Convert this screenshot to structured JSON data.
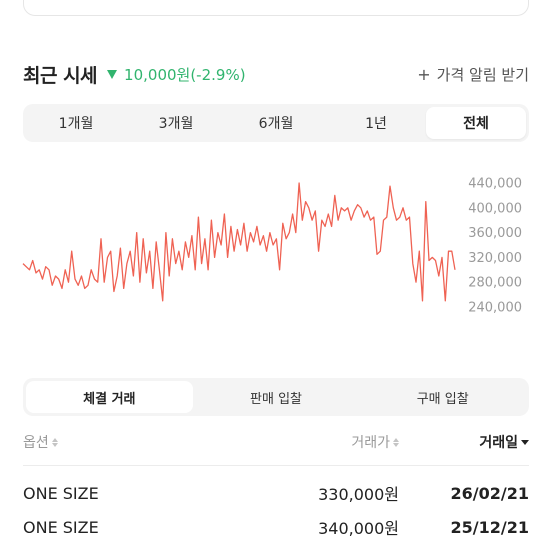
{
  "header": {
    "title": "최근 시세",
    "change_text": "10,000원(-2.9%)",
    "change_color": "#31b46e",
    "alert_label": "가격 알림 받기"
  },
  "period_tabs": [
    {
      "label": "1개월",
      "active": false
    },
    {
      "label": "3개월",
      "active": false
    },
    {
      "label": "6개월",
      "active": false
    },
    {
      "label": "1년",
      "active": false
    },
    {
      "label": "전체",
      "active": true
    }
  ],
  "chart_data": {
    "type": "line",
    "line_color": "#ef6253",
    "y_ticks": [
      "440,000",
      "400,000",
      "360,000",
      "320,000",
      "280,000",
      "240,000"
    ],
    "ylim": [
      240000,
      440000
    ],
    "values": [
      310000,
      305000,
      300000,
      315000,
      295000,
      300000,
      285000,
      305000,
      300000,
      275000,
      290000,
      285000,
      270000,
      300000,
      280000,
      330000,
      285000,
      275000,
      290000,
      270000,
      275000,
      300000,
      285000,
      280000,
      350000,
      280000,
      320000,
      330000,
      265000,
      290000,
      335000,
      270000,
      310000,
      330000,
      290000,
      360000,
      280000,
      350000,
      295000,
      330000,
      270000,
      345000,
      300000,
      250000,
      360000,
      290000,
      350000,
      310000,
      330000,
      300000,
      345000,
      320000,
      355000,
      300000,
      385000,
      310000,
      350000,
      300000,
      380000,
      320000,
      360000,
      340000,
      390000,
      320000,
      370000,
      330000,
      365000,
      340000,
      375000,
      330000,
      360000,
      345000,
      370000,
      340000,
      355000,
      330000,
      360000,
      340000,
      350000,
      300000,
      375000,
      350000,
      360000,
      390000,
      360000,
      440000,
      380000,
      410000,
      400000,
      380000,
      395000,
      330000,
      380000,
      370000,
      390000,
      370000,
      420000,
      380000,
      400000,
      395000,
      400000,
      380000,
      395000,
      405000,
      400000,
      385000,
      395000,
      380000,
      385000,
      325000,
      330000,
      380000,
      385000,
      435000,
      400000,
      380000,
      385000,
      400000,
      380000,
      385000,
      310000,
      280000,
      330000,
      250000,
      410000,
      315000,
      320000,
      315000,
      290000,
      320000,
      250000,
      330000,
      330000,
      300000
    ]
  },
  "trade_tabs": [
    {
      "label": "체결 거래",
      "active": true
    },
    {
      "label": "판매 입찰",
      "active": false
    },
    {
      "label": "구매 입찰",
      "active": false
    }
  ],
  "table": {
    "headers": {
      "option": "옵션",
      "price": "거래가",
      "date": "거래일"
    },
    "rows": [
      {
        "option": "ONE SIZE",
        "price": "330,000원",
        "date": "26/02/21"
      },
      {
        "option": "ONE SIZE",
        "price": "340,000원",
        "date": "25/12/21"
      }
    ]
  }
}
